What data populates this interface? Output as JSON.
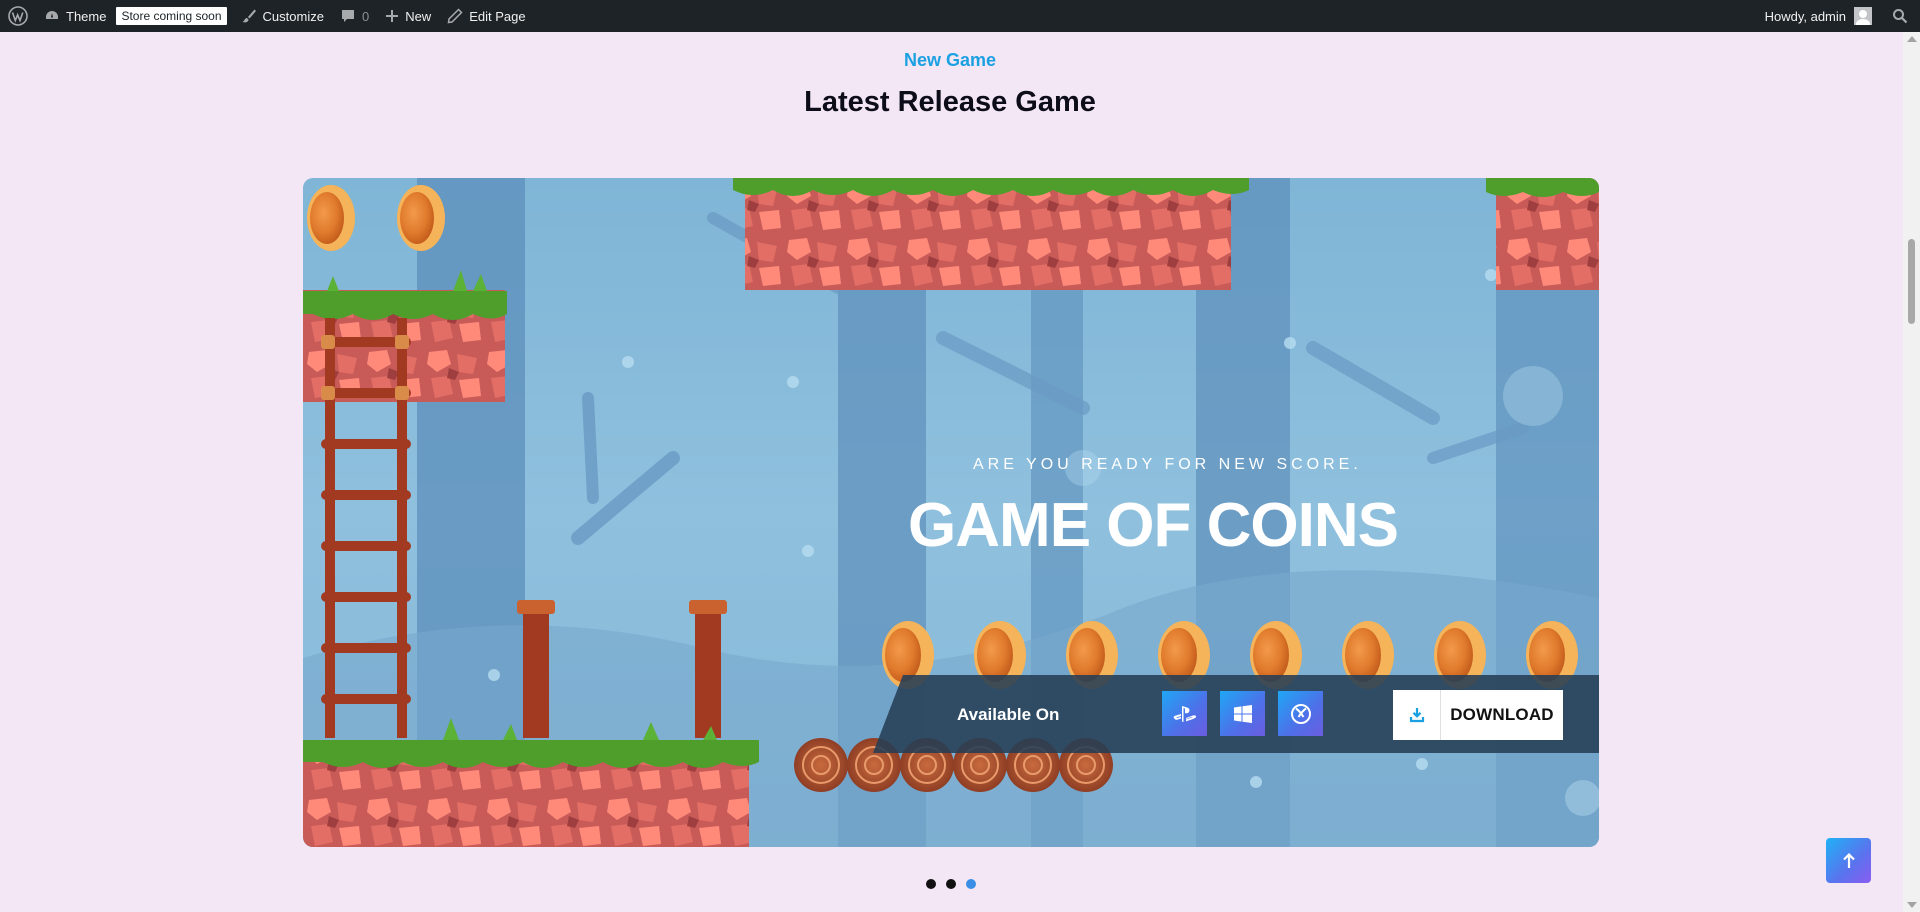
{
  "adminbar": {
    "theme_label": "Theme",
    "store_badge": "Store coming soon",
    "customize_label": "Customize",
    "comments_count": "0",
    "new_label": "New",
    "edit_page_label": "Edit Page",
    "howdy_label": "Howdy, admin"
  },
  "section": {
    "kicker": "New Game",
    "title": "Latest Release Game"
  },
  "slide": {
    "tagline": "ARE YOU READY FOR NEW SCORE.",
    "game_name": "GAME OF COINS",
    "available_label": "Available On",
    "platforms": [
      "playstation-icon",
      "windows-icon",
      "xbox-icon"
    ],
    "download_label": "DOWNLOAD"
  },
  "slider": {
    "dot_count": 3,
    "active_dot": 3
  },
  "colors": {
    "accent": "#1ba1e2",
    "page_bg": "#f3e6f5",
    "adminbar_bg": "#1d2327",
    "button_gradient_start": "#1fa6f5",
    "button_gradient_end": "#6a5de0"
  }
}
